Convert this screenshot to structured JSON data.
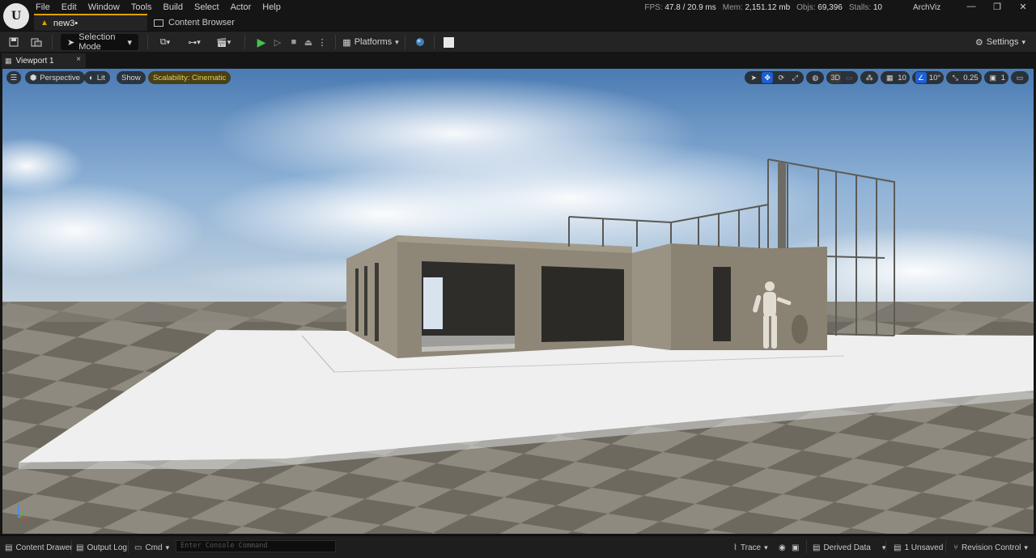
{
  "menu": [
    "File",
    "Edit",
    "Window",
    "Tools",
    "Build",
    "Select",
    "Actor",
    "Help"
  ],
  "tabs": {
    "level": "new3•",
    "content_browser": "Content Browser"
  },
  "stats": {
    "fps_label": "FPS:",
    "fps": "47.8",
    "ms": "/ 20.9 ms",
    "mem_label": "Mem:",
    "mem": "2,151.12 mb",
    "objs_label": "Objs:",
    "objs": "69,396",
    "stalls_label": "Stalls:",
    "stalls": "10"
  },
  "project_name": "ArchViz",
  "toolbar": {
    "selection_mode": "Selection Mode",
    "platforms": "Platforms",
    "settings": "Settings"
  },
  "viewport_tab": {
    "label": "Viewport 1",
    "close": "×"
  },
  "viewport": {
    "perspective": "Perspective",
    "lit": "Lit",
    "show": "Show",
    "scalability": "Scalability: Cinematic",
    "grid_snap": "10",
    "rot_snap": "10°",
    "scale_snap": "0.25",
    "camera_speed": "1",
    "mode_3d": "3D"
  },
  "statusbar": {
    "content_drawer": "Content Drawer",
    "output_log": "Output Log",
    "cmd": "Cmd",
    "console_placeholder": "Enter Console Command",
    "trace": "Trace",
    "derived_data": "Derived Data",
    "unsaved": "1 Unsaved",
    "revision_control": "Revision Control"
  },
  "colors": {
    "accent": "#e0a000",
    "play": "#47c24e",
    "active_tool": "#1f5fd0",
    "scalability": "#e9cc5a"
  }
}
